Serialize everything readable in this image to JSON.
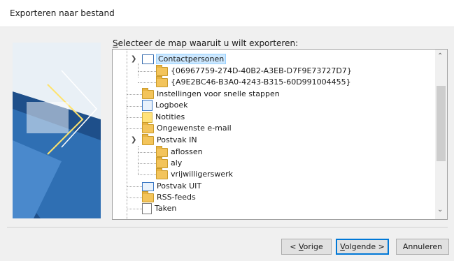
{
  "window": {
    "title": "Exporteren naar bestand"
  },
  "prompt": {
    "mnemonic": "S",
    "text": "electeer de map waaruit u wilt exporteren:"
  },
  "tree": {
    "items": [
      {
        "label": "Contactpersonen",
        "icon": "contacts-folder-icon",
        "selected": true
      },
      {
        "label": "{06967759-274D-40B2-A3EB-D7F9E73727D7}",
        "icon": "folder-icon"
      },
      {
        "label": "{A9E2BC46-B3A0-4243-B315-60D991004455}",
        "icon": "folder-icon"
      },
      {
        "label": "Instellingen voor snelle stappen",
        "icon": "folder-icon"
      },
      {
        "label": "Logboek",
        "icon": "journal-icon"
      },
      {
        "label": "Notities",
        "icon": "notes-icon"
      },
      {
        "label": "Ongewenste e-mail",
        "icon": "folder-icon"
      },
      {
        "label": "Postvak IN",
        "icon": "inbox-icon"
      },
      {
        "label": "aflossen",
        "icon": "folder-icon"
      },
      {
        "label": "aly",
        "icon": "folder-icon"
      },
      {
        "label": "vrijwilligerswerk",
        "icon": "folder-icon"
      },
      {
        "label": "Postvak UIT",
        "icon": "outbox-icon"
      },
      {
        "label": "RSS-feeds",
        "icon": "folder-icon"
      },
      {
        "label": "Taken",
        "icon": "tasks-icon"
      }
    ]
  },
  "buttons": {
    "back": {
      "pre": "< ",
      "mnemonic": "V",
      "post": "orige"
    },
    "next": {
      "mnemonic": "V",
      "post": "olgende >"
    },
    "cancel": {
      "label": "Annuleren"
    }
  },
  "colors": {
    "selection": "#cce8ff",
    "accent": "#0078d7",
    "folder": "#f3c45b"
  }
}
